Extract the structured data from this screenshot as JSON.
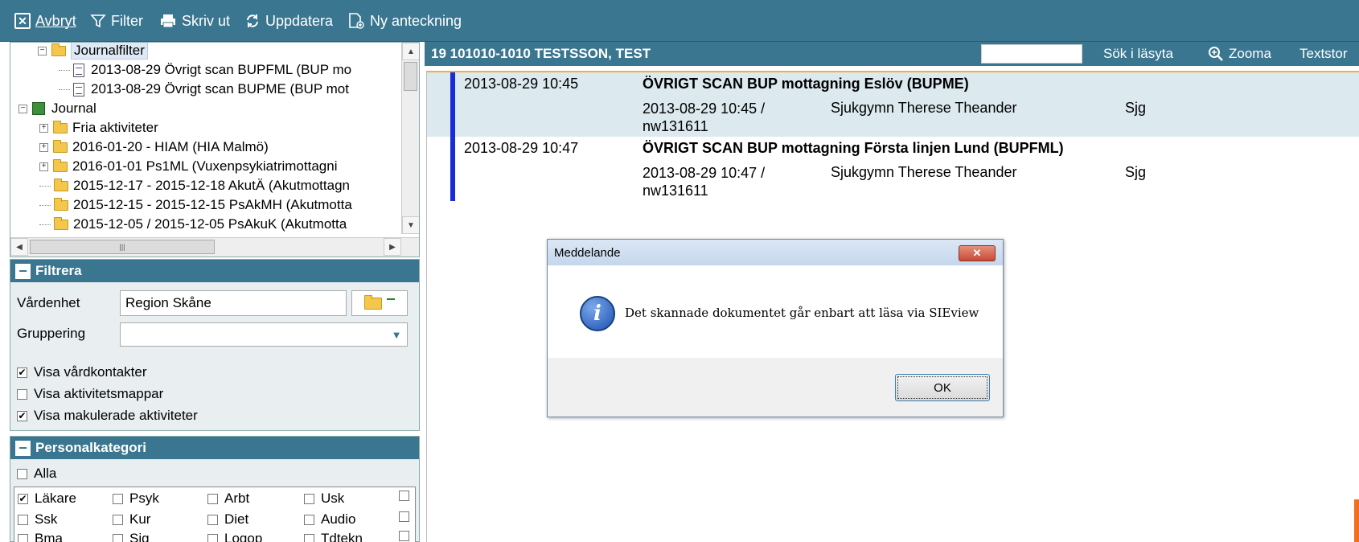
{
  "toolbar": {
    "cancel_label": "Avbryt",
    "filter_label": "Filter",
    "print_label": "Skriv ut",
    "refresh_label": "Uppdatera",
    "new_note_label": "Ny anteckning"
  },
  "tree": {
    "items": [
      {
        "label": "Journalfilter",
        "type": "folder-filter",
        "selected": true
      },
      {
        "label": "2013-08-29 Övrigt scan BUPFML (BUP mo",
        "type": "doc"
      },
      {
        "label": "2013-08-29 Övrigt scan BUPME (BUP mot",
        "type": "doc"
      },
      {
        "label": "Journal",
        "type": "journal"
      },
      {
        "label": "Fria aktiviteter",
        "type": "folder"
      },
      {
        "label": "2016-01-20 -   HIAM (HIA Malmö)",
        "type": "folder"
      },
      {
        "label": "2016-01-01    Ps1ML (Vuxenpsykiatrimottagni",
        "type": "folder"
      },
      {
        "label": "2015-12-17 - 2015-12-18 AkutÄ (Akutmottagn",
        "type": "folder"
      },
      {
        "label": "2015-12-15 - 2015-12-15 PsAkMH (Akutmotta",
        "type": "folder"
      },
      {
        "label": "2015-12-05 / 2015-12-05 PsAkuK (Akutmotta",
        "type": "folder"
      }
    ]
  },
  "filter_section": {
    "title": "Filtrera",
    "unit_label": "Vårdenhet",
    "unit_value": "Region Skåne",
    "grouping_label": "Gruppering",
    "grouping_value": "",
    "checks": [
      {
        "label": "Visa vårdkontakter",
        "checked": true
      },
      {
        "label": "Visa aktivitetsmappar",
        "checked": false
      },
      {
        "label": "Visa makulerade aktiviteter",
        "checked": true
      }
    ]
  },
  "staff_section": {
    "title": "Personalkategori",
    "all_label": "Alla",
    "all_checked": false,
    "rows": [
      [
        {
          "label": "Läkare",
          "checked": true
        },
        {
          "label": "Psyk",
          "checked": false
        },
        {
          "label": "Arbt",
          "checked": false
        },
        {
          "label": "Usk",
          "checked": false
        }
      ],
      [
        {
          "label": "Ssk",
          "checked": false
        },
        {
          "label": "Kur",
          "checked": false
        },
        {
          "label": "Diet",
          "checked": false
        },
        {
          "label": "Audio",
          "checked": false
        }
      ],
      [
        {
          "label": "Bma",
          "checked": false
        },
        {
          "label": "Sjg",
          "checked": false
        },
        {
          "label": "Logop",
          "checked": false
        },
        {
          "label": "Tdtekn",
          "checked": false
        }
      ]
    ]
  },
  "patient_bar": {
    "name": "19 101010-1010 TESTSSON, TEST",
    "search_label": "Sök i läsyta",
    "zoom_label": "Zooma",
    "textsize_label": "Textstor"
  },
  "entries": [
    {
      "datetime": "2013-08-29 10:45",
      "title": "ÖVRIGT SCAN   BUP mottagning Eslöv (BUPME)",
      "sub_line1": "2013-08-29 10:45 /",
      "sub_line2": "nw131611",
      "staff": "Sjukgymn Therese Theander",
      "code": "Sjg",
      "highlighted": true
    },
    {
      "datetime": "2013-08-29 10:47",
      "title": "ÖVRIGT SCAN   BUP mottagning Första linjen Lund (BUPFML)",
      "sub_line1": "2013-08-29 10:47 /",
      "sub_line2": "nw131611",
      "staff": "Sjukgymn Therese Theander",
      "code": "Sjg",
      "highlighted": false
    }
  ],
  "dialog": {
    "title": "Meddelande",
    "message": "Det skannade dokumentet går enbart att läsa via SIEview",
    "ok_label": "OK",
    "close_glyph": "✕"
  },
  "colors": {
    "header_blue": "#3a7690",
    "entry_bar": "#1a2bd8",
    "highlight_row": "#dce9ee",
    "accent_orange": "#f07020"
  }
}
